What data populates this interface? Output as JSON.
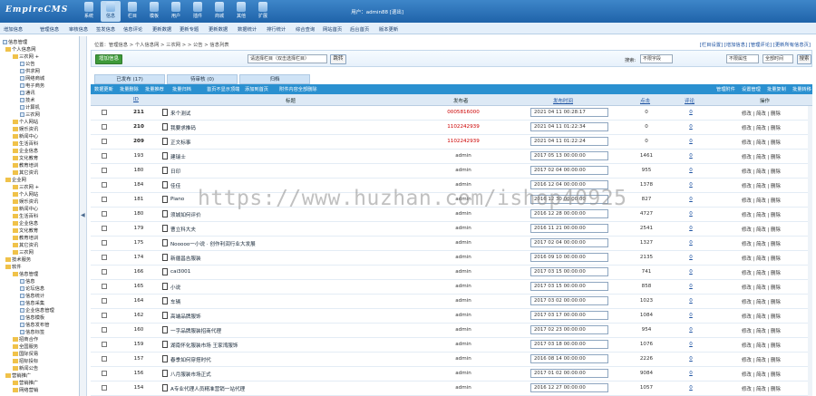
{
  "app": {
    "logo": "EmpireCMS",
    "user": "用户：admin88 [退出]"
  },
  "topnav": [
    {
      "label": "系统",
      "active": false
    },
    {
      "label": "信息",
      "active": true
    },
    {
      "label": "栏目",
      "active": false
    },
    {
      "label": "模板",
      "active": false
    },
    {
      "label": "用户",
      "active": false
    },
    {
      "label": "插件",
      "active": false
    },
    {
      "label": "商城",
      "active": false
    },
    {
      "label": "其他",
      "active": false
    },
    {
      "label": "扩展",
      "active": false
    }
  ],
  "subnav": [
    "增加信息",
    "管理信息",
    "审核信息",
    "签发信息",
    "信息评论",
    "更新数据",
    "更新专题",
    "更新数据",
    "数据统计",
    "排行统计",
    "综合查询",
    "网站首页",
    "后台首页",
    "版本更新"
  ],
  "sidebar": {
    "title": "信息管理",
    "items": [
      {
        "label": "个人信息网",
        "indent": 0
      },
      {
        "label": "三农网 +",
        "indent": 1
      },
      {
        "label": "公告",
        "indent": 2
      },
      {
        "label": "供求网",
        "indent": 2
      },
      {
        "label": "网络商城",
        "indent": 2
      },
      {
        "label": "电子商务",
        "indent": 2
      },
      {
        "label": "通讯",
        "indent": 2
      },
      {
        "label": "技术",
        "indent": 2
      },
      {
        "label": "计算机",
        "indent": 2
      },
      {
        "label": "三农网",
        "indent": 2
      },
      {
        "label": "个人网站",
        "indent": 1
      },
      {
        "label": "娱乐资讯",
        "indent": 1
      },
      {
        "label": "新闻中心",
        "indent": 1
      },
      {
        "label": "生活百科",
        "indent": 1
      },
      {
        "label": "企业信息",
        "indent": 1
      },
      {
        "label": "文化教育",
        "indent": 1
      },
      {
        "label": "教育培训",
        "indent": 1
      },
      {
        "label": "其它资讯",
        "indent": 1
      },
      {
        "label": "企业网",
        "indent": 0
      },
      {
        "label": "三农网 +",
        "indent": 1
      },
      {
        "label": "个人网站",
        "indent": 1
      },
      {
        "label": "娱乐资讯",
        "indent": 1
      },
      {
        "label": "新闻中心",
        "indent": 1
      },
      {
        "label": "生活百科",
        "indent": 1
      },
      {
        "label": "企业信息",
        "indent": 1
      },
      {
        "label": "文化教育",
        "indent": 1
      },
      {
        "label": "教育培训",
        "indent": 1
      },
      {
        "label": "其它资讯",
        "indent": 1
      },
      {
        "label": "三农网",
        "indent": 1
      },
      {
        "label": "技术服务",
        "indent": 0
      },
      {
        "label": "软件",
        "indent": 0
      },
      {
        "label": "信息管理",
        "indent": 1
      },
      {
        "label": "信息",
        "indent": 2
      },
      {
        "label": "论坛信息",
        "indent": 2
      },
      {
        "label": "信息统计",
        "indent": 2
      },
      {
        "label": "信息采集",
        "indent": 2
      },
      {
        "label": "企业信息管理",
        "indent": 2
      },
      {
        "label": "信息模板",
        "indent": 2
      },
      {
        "label": "信息发布管",
        "indent": 2
      },
      {
        "label": "信息标签",
        "indent": 2
      },
      {
        "label": "招商合作",
        "indent": 1
      },
      {
        "label": "全国服务",
        "indent": 1
      },
      {
        "label": "国际贸易",
        "indent": 1
      },
      {
        "label": "招标投标",
        "indent": 1
      },
      {
        "label": "新闻公告",
        "indent": 1
      },
      {
        "label": "营销推广",
        "indent": 0
      },
      {
        "label": "营销推广",
        "indent": 1
      },
      {
        "label": "网络营销",
        "indent": 1
      }
    ]
  },
  "breadcrumb": "位置：管理信息 > 个人信息网 > 三农网 > > 公告 > 信息列表",
  "toplinks": "[栏目设置] [增加信息] [管理评论] [更新所有信息页]",
  "filter": {
    "add_btn": "增加信息",
    "category_select": "请选择栏目（双击选择栏目）",
    "go_btn": "跳转",
    "search_label": "搜索:",
    "search_select": "不限字段",
    "keyword_select": "不限属性",
    "order_select": "全部时间",
    "search_btn": "搜索"
  },
  "tabs": [
    {
      "label": "已发布 (17)",
      "active": true
    },
    {
      "label": "待审核 (0)",
      "active": false
    },
    {
      "label": "归档",
      "active": false
    }
  ],
  "actions_left": [
    "数据更新",
    "批量删除",
    "批量推荐",
    "批量归档",
    "首页不显示顶端",
    "添加到首页",
    "附件内容全部删除"
  ],
  "actions_right": [
    "管理附件",
    "设置管理",
    "批量复制",
    "批量转移"
  ],
  "columns": {
    "id": "ID",
    "title": "标题",
    "publisher": "发布者",
    "pubtime": "发布时间",
    "clicks": "点击",
    "comments": "评论",
    "ops": "操作"
  },
  "rows": [
    {
      "id": "211",
      "title": "来个测试",
      "publisher": "0005816000",
      "pub_red": true,
      "date": "2021 04 11 00:28:17",
      "clicks": "0",
      "comments": "0",
      "bold": true
    },
    {
      "id": "210",
      "title": "我要求推码",
      "publisher": "1102242939",
      "pub_red": true,
      "date": "2021 04 11 01:22:34",
      "clicks": "0",
      "comments": "0",
      "bold": true
    },
    {
      "id": "209",
      "title": "正文标事",
      "publisher": "1102242939",
      "pub_red": true,
      "date": "2021 04 11 01:22:24",
      "clicks": "0",
      "comments": "0",
      "bold": true
    },
    {
      "id": "193",
      "title": "建瑞士",
      "publisher": "admin",
      "pub_red": false,
      "date": "2017 05 13 00:00:00",
      "clicks": "1461",
      "comments": "0",
      "bold": false
    },
    {
      "id": "180",
      "title": "日印",
      "publisher": "admin",
      "pub_red": false,
      "date": "2017 02 04 00:00:00",
      "clicks": "955",
      "comments": "0",
      "bold": false
    },
    {
      "id": "184",
      "title": "佳佳",
      "publisher": "admin",
      "pub_red": false,
      "date": "2016 12 04 00:00:00",
      "clicks": "1378",
      "comments": "0",
      "bold": false
    },
    {
      "id": "181",
      "title": "Piano",
      "publisher": "admin",
      "pub_red": false,
      "date": "2016 12 30 00:00:00",
      "clicks": "827",
      "comments": "0",
      "bold": false
    },
    {
      "id": "180",
      "title": "须城如何评价",
      "publisher": "admin",
      "pub_red": false,
      "date": "2016 12 28 00:00:00",
      "clicks": "4727",
      "comments": "0",
      "bold": false
    },
    {
      "id": "179",
      "title": "曹立科大夫",
      "publisher": "admin",
      "pub_red": false,
      "date": "2016 11 21 00:00:00",
      "clicks": "2541",
      "comments": "0",
      "bold": false
    },
    {
      "id": "175",
      "title": "Nooooo一小说 · 创作利润行业大发展",
      "publisher": "admin",
      "pub_red": false,
      "date": "2017 02 04 00:00:00",
      "clicks": "1327",
      "comments": "0",
      "bold": false
    },
    {
      "id": "174",
      "title": "新疆昌吉服装",
      "publisher": "admin",
      "pub_red": false,
      "date": "2016 09 10 00:00:00",
      "clicks": "2135",
      "comments": "0",
      "bold": false
    },
    {
      "id": "166",
      "title": "cai3001",
      "publisher": "admin",
      "pub_red": false,
      "date": "2017 03 15 00:00:00",
      "clicks": "741",
      "comments": "0",
      "bold": false
    },
    {
      "id": "165",
      "title": "小说",
      "publisher": "admin",
      "pub_red": false,
      "date": "2017 03 15 00:00:00",
      "clicks": "858",
      "comments": "0",
      "bold": false
    },
    {
      "id": "164",
      "title": "车辆",
      "publisher": "admin",
      "pub_red": false,
      "date": "2017 03 02 00:00:00",
      "clicks": "1023",
      "comments": "0",
      "bold": false
    },
    {
      "id": "162",
      "title": "高端品牌服饰",
      "publisher": "admin",
      "pub_red": false,
      "date": "2017 03 17 00:00:00",
      "clicks": "1084",
      "comments": "0",
      "bold": false
    },
    {
      "id": "160",
      "title": "一字品牌服装招商代理",
      "publisher": "admin",
      "pub_red": false,
      "date": "2017 02 23 00:00:00",
      "clicks": "954",
      "comments": "0",
      "bold": false
    },
    {
      "id": "159",
      "title": "湖南怀化服装市场 王家湾服饰",
      "publisher": "admin",
      "pub_red": false,
      "date": "2017 03 18 00:00:00",
      "clicks": "1076",
      "comments": "0",
      "bold": false
    },
    {
      "id": "157",
      "title": "春季如何穿搭时代",
      "publisher": "admin",
      "pub_red": false,
      "date": "2016 08 14 00:00:00",
      "clicks": "2226",
      "comments": "0",
      "bold": false
    },
    {
      "id": "156",
      "title": "八月服装市场正式",
      "publisher": "admin",
      "pub_red": false,
      "date": "2017 01 02 00:00:00",
      "clicks": "9084",
      "comments": "0",
      "bold": false
    },
    {
      "id": "154",
      "title": "A专业代理人员精准营销一站代理",
      "publisher": "admin",
      "pub_red": false,
      "date": "2016 12 27 00:00:00",
      "clicks": "1057",
      "comments": "0",
      "bold": false
    }
  ],
  "row_ops": "修改 | 简改 | 删除",
  "watermark": "https://www.huzhan.com/ishop40925"
}
